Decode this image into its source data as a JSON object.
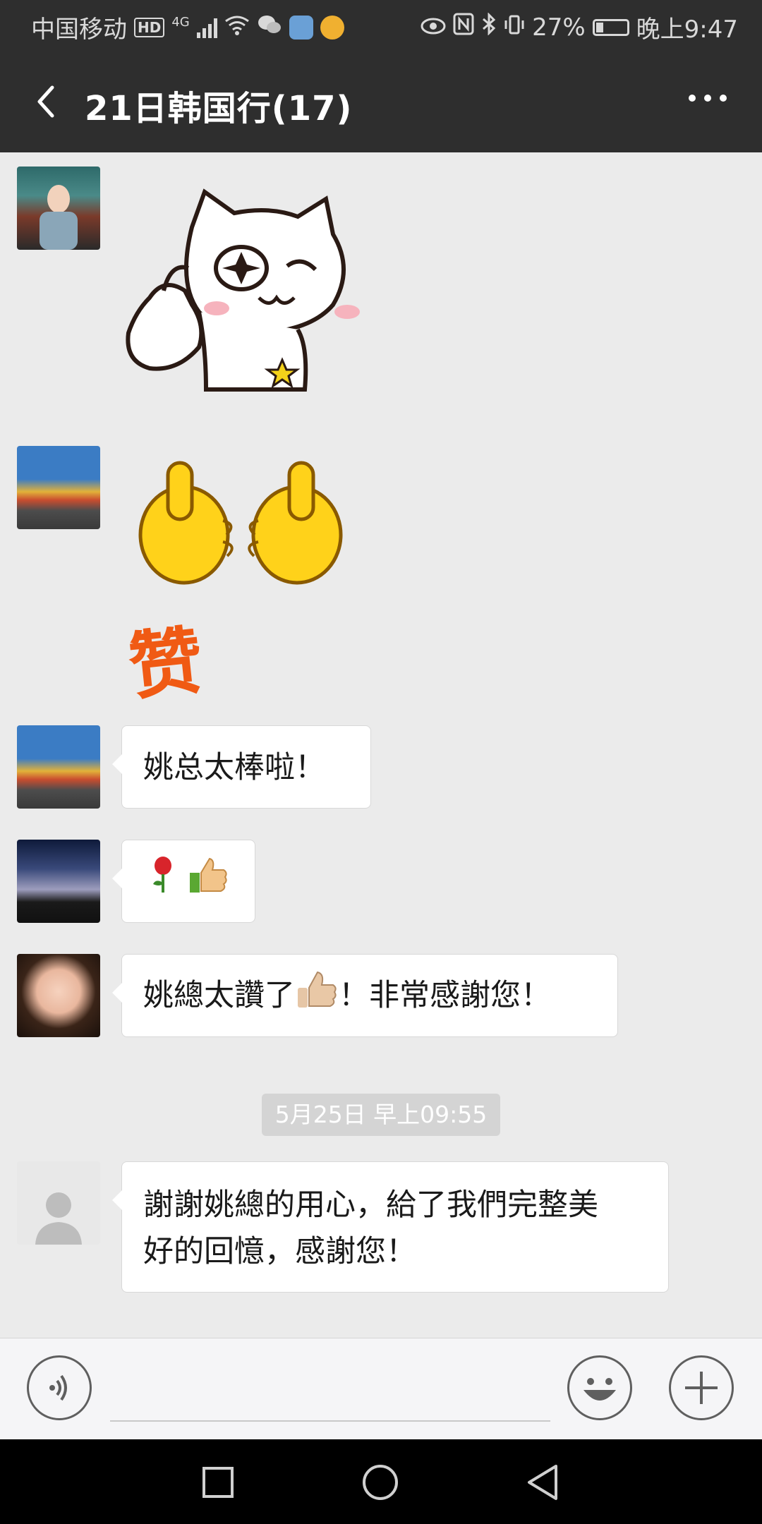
{
  "status_bar": {
    "carrier": "中国移动",
    "hd_badge": "HD",
    "network": "4G",
    "battery_percent": "27%",
    "time": "晚上9:47"
  },
  "header": {
    "title": "21日韩国行(17)"
  },
  "messages": [
    {
      "type": "sticker",
      "sticker": "cat-thumbs-up-wink"
    },
    {
      "type": "sticker",
      "sticker": "double-thumbs-up-zan",
      "sticker_text": "赞"
    },
    {
      "type": "text",
      "text": "姚总太棒啦！"
    },
    {
      "type": "emoji",
      "emojis": [
        "rose-emoji",
        "thumbs-up-emoji"
      ]
    },
    {
      "type": "text",
      "text_before": "姚總太讚了",
      "text_after": "！非常感謝您！"
    },
    {
      "type": "text",
      "line1": "謝謝姚總的用心，給了我們完整美",
      "line2": "好的回憶，感謝您！"
    }
  ],
  "timestamp": "5月25日 早上09:55",
  "colors": {
    "header_bg": "#2e2e2e",
    "chat_bg": "#ebebeb",
    "bubble_bg": "#ffffff",
    "timestamp_bg": "#d4d4d4"
  }
}
